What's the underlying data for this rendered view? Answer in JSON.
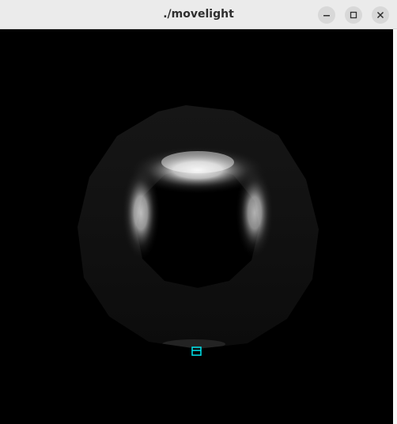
{
  "window": {
    "title": "./movelight",
    "controls": {
      "minimize_icon": "minimize-icon",
      "maximize_icon": "maximize-icon",
      "close_icon": "close-icon"
    }
  },
  "scene": {
    "background_color": "#000000",
    "torus_base_color": "#101010",
    "highlight_color": "#ffffff",
    "light_marker_color": "#00e5ee"
  }
}
